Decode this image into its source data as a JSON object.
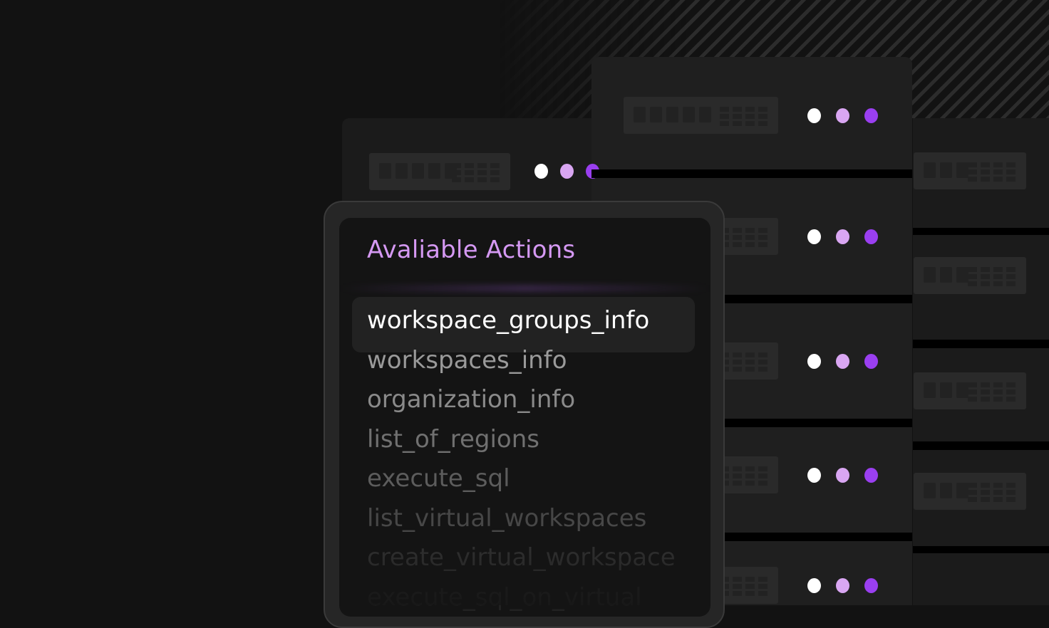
{
  "card": {
    "title": "Avaliable Actions"
  },
  "actions": [
    {
      "label": "workspace_groups_info",
      "state": "selected"
    },
    {
      "label": "workspaces_info"
    },
    {
      "label": "organization_info"
    },
    {
      "label": "list_of_regions"
    },
    {
      "label": "execute_sql"
    },
    {
      "label": "list_virtual_workspaces"
    },
    {
      "label": "create_virtual_workspace"
    },
    {
      "label": "execute_sql_on_virtual"
    }
  ],
  "server_status_lights": [
    "white",
    "lilac",
    "purple"
  ],
  "colors": {
    "background": "#121212",
    "accent_title": "#d599f3",
    "light_white": "#ffffff",
    "light_lilac": "#d9a6f2",
    "light_purple": "#9a3ff0",
    "selected_text": "#ffffff"
  }
}
